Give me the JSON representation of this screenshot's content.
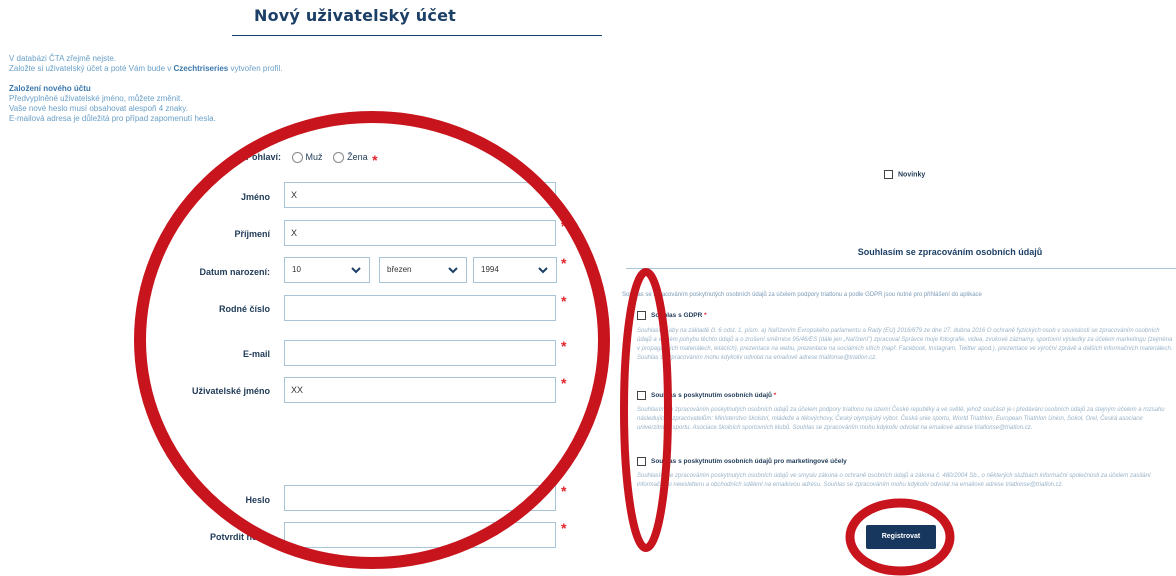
{
  "header": {
    "title": "Nový uživatelský účet"
  },
  "intro": {
    "line1": "V databázi ČTA zřejmě nejste.",
    "line2_pre": "Založte si uživatelský účet a poté Vám bude v ",
    "line2_brand": "Czechtriseries",
    "line2_post": " vytvořen profil.",
    "section_title": "Založení nového účtu",
    "notes": [
      "Předvyplněné uživatelské jméno, můžete změnit.",
      "Vaše nové heslo musí obsahovat alespoň 4 znaky.",
      "E-mailová adresa je důležitá pro případ zapomenutí hesla."
    ]
  },
  "form": {
    "gender": {
      "label": "Pohlaví:",
      "options": [
        "Muž",
        "Žena"
      ]
    },
    "first_name": {
      "label": "Jméno",
      "value": "X"
    },
    "last_name": {
      "label": "Příjmení",
      "value": "X"
    },
    "birth_date": {
      "label": "Datum narození:",
      "day": "10",
      "month": "březen",
      "year": "1994"
    },
    "birth_number": {
      "label": "Rodné číslo",
      "value": ""
    },
    "email": {
      "label": "E-mail",
      "value": ""
    },
    "username": {
      "label": "Uživatelské jméno",
      "value": "XX"
    },
    "password": {
      "label": "Heslo",
      "value": ""
    },
    "password_confirm": {
      "label": "Potvrdit heslo",
      "value": ""
    },
    "required_mark": "*"
  },
  "newsletter": {
    "label": "Novinky"
  },
  "consent": {
    "title": "Souhlasím se zpracováním osobních údajů",
    "intro": "Souhlas se zpracováním poskytnutých osobních údajů za účelem podpory triatlonu a podle GDPR jsou nutné pro přihlášení do aplikace",
    "items": [
      {
        "label": "Souhlas s GDPR",
        "required": "*",
        "text": "Souhlasím, aby na základě čl. 6 odst. 1, písm. a) Nařízením Evropského parlamentu a Rady (EU) 2016/679 ze dne 27. dubna 2016 O ochraně fyzických osob v souvislosti se zpracováním osobních údajů a volném pohybu těchto údajů a o zrušení směrnice 95/46/ES (dále jen „Nařízení\") zpracoval Správce moje fotografie, videa, zvukové záznamy, sportovní výsledky za účelem marketingu (zejména v propagačních materiálech, letácích), prezentace na webu, prezentace na sociálních sítích (např. Facebook, Instagram, Twitter apod.), prezentace ve výroční zprávě a dalších informačních materiálech. Souhlas se zpracováním mohu kdykoliv odvolat na emailové adrese triatlonse@triatlon.cz."
      },
      {
        "label": "Souhlas s poskytnutím osobních údajů",
        "required": "*",
        "text": "Souhlasím se zpracováním poskytnutých osobních údajů za účelem podpory triatlonu na území České republiky a ve světě, jehož součástí je i předávání osobních údajů za stejným účelem a rozsahu následujícím zpracovatelům: Ministerstvo školství, mládeže a tělovýchovy, Český olympijský výbor, Česká unie sportu, World Triathlon, European Triathlon Union, Sokol, Orel, Česká asociace univerzitního sportu, Asociace školních sportovních klubů. Souhlas se zpracováním mohu kdykoliv odvolat na emailové adrese triatlonse@triatlon.cz."
      },
      {
        "label": "Souhlas s poskytnutím osobních údajů pro marketingové účely",
        "required": "",
        "text": "Souhlasím se zpracováním poskytnutých osobních údajů ve smyslu zákona o ochraně osobních údajů a zákona č. 480/2004 Sb., o některých službách informační společnosti za účelem zasílání informačního newsletteru a obchodních sdělení na emailovou adresu. Souhlas se zpracováním mohu kdykoliv odvolat na emailové adrese triatlonse@triatlon.cz."
      }
    ]
  },
  "submit": {
    "label": "Registrovat"
  },
  "colors": {
    "accent": "#17375e",
    "required": "#e0262d",
    "annotation": "#c8141d"
  }
}
